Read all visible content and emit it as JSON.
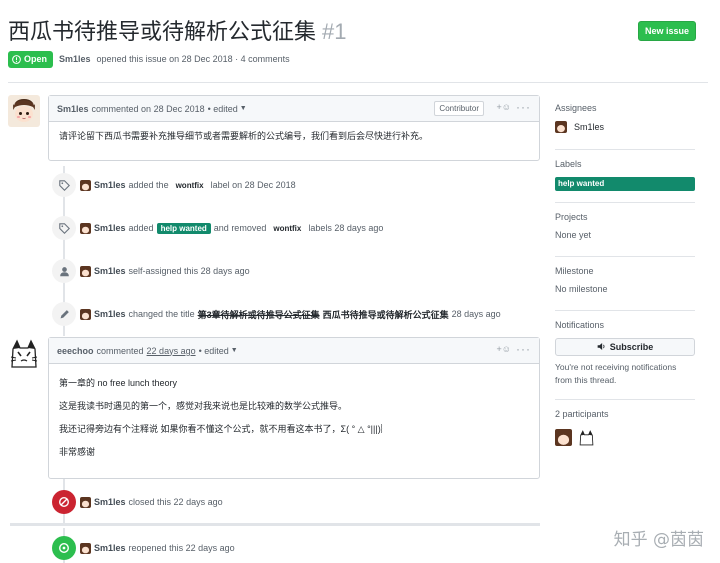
{
  "issue": {
    "title": "西瓜书待推导或待解析公式征集",
    "number": "#1",
    "new_issue_label": "New issue",
    "state": "Open",
    "author": "Sm1les",
    "meta_text": "opened this issue on 28 Dec 2018 · 4 comments"
  },
  "comments": [
    {
      "author": "Sm1les",
      "action": "commented on 28 Dec 2018",
      "edited": "• edited",
      "badge": "Contributor",
      "paragraphs": [
        "请评论留下西瓜书需要补充推导细节或者需要解析的公式编号，我们看到后会尽快进行补充。"
      ]
    },
    {
      "author": "eeechoo",
      "action": "commented",
      "time": "22 days ago",
      "edited": "• edited",
      "paragraphs": [
        "第一章的 no free lunch theory",
        "这是我读书时遇见的第一个，感觉对我来说也是比较难的数学公式推导。",
        "我还记得旁边有个注释说 如果你看不懂这个公式，就不用看这本书了，Σ( ° △ °|||)︴",
        "非常感谢"
      ]
    }
  ],
  "events": [
    {
      "actor": "Sm1les",
      "text_a": "added the",
      "label_a": "wontfix",
      "text_b": "label on 28 Dec 2018"
    },
    {
      "actor": "Sm1les",
      "text_a": "added",
      "label_a": "help wanted",
      "text_b": "and removed",
      "label_b": "wontfix",
      "text_c": "labels 28 days ago"
    },
    {
      "actor": "Sm1les",
      "text_a": "self-assigned this 28 days ago"
    },
    {
      "actor": "Sm1les",
      "text_a": "changed the title",
      "old_title": "第3章待解析或待推导公式征集",
      "new_title": "西瓜书待推导或待解析公式征集",
      "time": "28 days ago"
    },
    {
      "actor": "Sm1les",
      "text_a": "closed this 22 days ago"
    },
    {
      "actor": "Sm1les",
      "text_a": "reopened this 22 days ago"
    }
  ],
  "sidebar": {
    "assignees_title": "Assignees",
    "assignee": "Sm1les",
    "labels_title": "Labels",
    "label": "help wanted",
    "projects_title": "Projects",
    "projects_value": "None yet",
    "milestone_title": "Milestone",
    "milestone_value": "No milestone",
    "notifications_title": "Notifications",
    "subscribe_label": "Subscribe",
    "notifications_note": "You're not receiving notifications from this thread.",
    "participants_title": "2 participants"
  },
  "watermark": "知乎 @茵茵",
  "colors": {
    "green": "#2cbe4e",
    "label_teal": "#128a6c",
    "red": "#cb2431"
  }
}
